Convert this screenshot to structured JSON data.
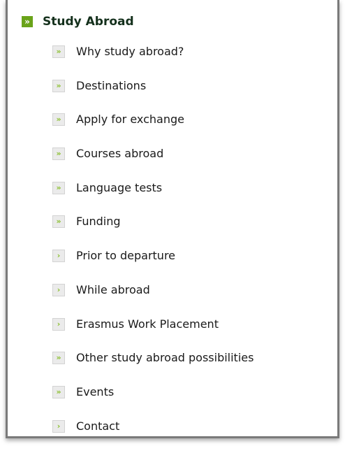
{
  "header": {
    "title": "Study Abroad",
    "icon": "double-chevron-right-icon",
    "icon_color": "#6aa31a"
  },
  "menu": {
    "items": [
      {
        "label": "Why study abroad?",
        "icon": "double-chevron-right-icon",
        "glyph": "»"
      },
      {
        "label": "Destinations",
        "icon": "double-chevron-right-icon",
        "glyph": "»"
      },
      {
        "label": "Apply for exchange",
        "icon": "double-chevron-right-icon",
        "glyph": "»"
      },
      {
        "label": "Courses abroad",
        "icon": "double-chevron-right-icon",
        "glyph": "»"
      },
      {
        "label": "Language tests",
        "icon": "double-chevron-right-icon",
        "glyph": "»"
      },
      {
        "label": "Funding",
        "icon": "double-chevron-right-icon",
        "glyph": "»"
      },
      {
        "label": "Prior to departure",
        "icon": "chevron-right-icon",
        "glyph": "›"
      },
      {
        "label": "While abroad",
        "icon": "chevron-right-icon",
        "glyph": "›"
      },
      {
        "label": "Erasmus Work Placement",
        "icon": "chevron-right-icon",
        "glyph": "›"
      },
      {
        "label": "Other study abroad possibilities",
        "icon": "double-chevron-right-icon",
        "glyph": "»"
      },
      {
        "label": "Events",
        "icon": "double-chevron-right-icon",
        "glyph": "»"
      },
      {
        "label": "Contact",
        "icon": "chevron-right-icon",
        "glyph": "›"
      }
    ]
  }
}
